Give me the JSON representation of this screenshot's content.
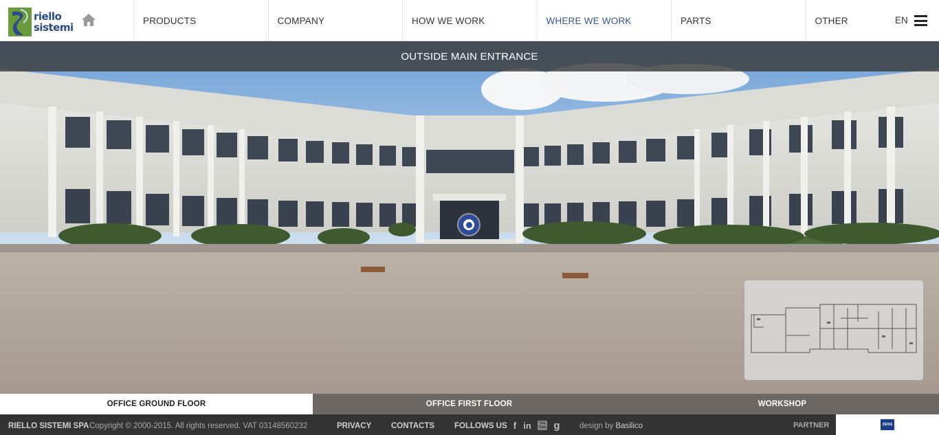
{
  "header": {
    "logo_line1": "riello",
    "logo_line2": "sistemi",
    "nav": [
      {
        "label": "PRODUCTS"
      },
      {
        "label": "COMPANY"
      },
      {
        "label": "HOW WE WORK"
      },
      {
        "label": "WHERE WE WORK"
      },
      {
        "label": "PARTS"
      },
      {
        "label": "OTHER"
      }
    ],
    "active_nav": "WHERE WE WORK",
    "language": "EN"
  },
  "panorama": {
    "title": "OUTSIDE MAIN ENTRANCE"
  },
  "floor_tabs": [
    {
      "label": "OFFICE GROUND FLOOR"
    },
    {
      "label": "OFFICE FIRST FLOOR"
    },
    {
      "label": "WORKSHOP"
    }
  ],
  "active_floor_tab": "OFFICE GROUND FLOOR",
  "footer": {
    "company": "RIELLO SISTEMI SPA",
    "copyright": "Copyright © 2000-2015. All rights reserved. VAT 03148560232",
    "privacy": "PRIVACY",
    "contacts": "CONTACTS",
    "follow_us": "FOLLOWS US",
    "social": {
      "facebook": "f",
      "linkedin": "in",
      "youtube": "You Tube",
      "google": "g"
    },
    "design_by": "design by",
    "designer": "Basilico",
    "partner": "PARTNER",
    "partner_logo": "ZEISS"
  },
  "icons": {
    "home": "home-icon",
    "menu": "hamburger-menu-icon",
    "hotspot": "navigation-hotspot-icon"
  },
  "colors": {
    "accent_blue": "#3a5494",
    "logo_green": "#6a9a3a",
    "footer_bg": "#333333",
    "tab_bg": "#5f5a56"
  }
}
